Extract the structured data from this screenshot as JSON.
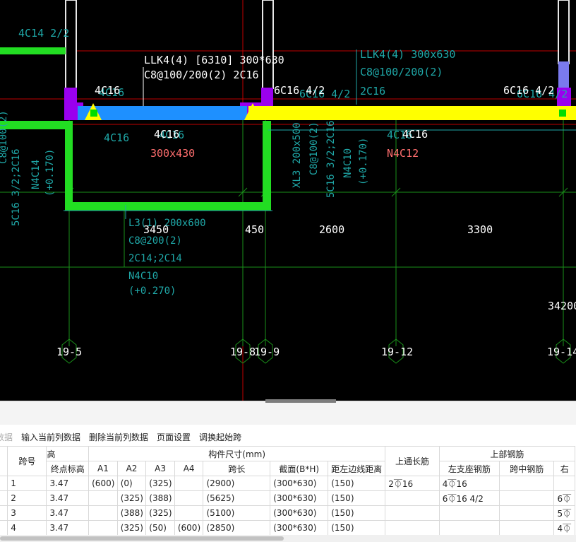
{
  "cad": {
    "beam_labels": {
      "llk4_left": "LLK4(4) [6310] 300*630",
      "llk4_left_line2": "C8@100/200(2) 2C16",
      "llk4_right": "LLK4(4) 300x630",
      "llk4_right_line2": "C8@100/200(2)",
      "llk4_right_line3": "2C16",
      "top_left_rebar": "4C14 2/2",
      "rebar_4c16_a": "4C16",
      "rebar_4c16_a_ghost": "4C16",
      "rebar_6c16_mid": "6C16 4/2",
      "rebar_6c16_mid_ghost": "6C16 4/2",
      "rebar_6c16_right": "6C16 4/2",
      "rebar_6c16_right_ghost": "6C16 4/2",
      "bottom_4c16_left": "4C16",
      "bottom_4c16_left_ghost": "4C16",
      "section_left": "300x430",
      "ghost_4c16_below": "4C16",
      "bottom_4c16_right": "4C16",
      "bottom_4c16_right_ghost": "4C16",
      "n4c12": "N4C12",
      "left_vert_1": "C8@100(2)",
      "left_vert_2": "5C16 3/2;2C16",
      "left_vert_3": "N4C14",
      "left_vert_4": "(+0.170)",
      "xl3_1": "XL3 200x500",
      "xl3_2": "C8@100(2)",
      "xl3_3": "5C16 3/2;2C16",
      "xl3_4": "N4C10",
      "xl3_5": "(+0.170)",
      "l3_1": "L3(1) 200x600",
      "l3_2": "C8@200(2)",
      "l3_3": "2C14;2C14",
      "l3_4": "N4C10",
      "l3_5": "(+0.270)"
    },
    "dimensions": [
      "3450",
      "450",
      "2600",
      "3300",
      "34200"
    ],
    "axes": [
      "19-5",
      "19-8",
      "19-9",
      "19-12",
      "19-14"
    ]
  },
  "toolbar": {
    "cut_item": "数据",
    "items": [
      "输入当前列数据",
      "删除当前列数据",
      "页面设置",
      "调换起始跨"
    ]
  },
  "table": {
    "header": {
      "span_no": "跨号",
      "elev_group": "高",
      "end_elev": "终点标高",
      "size_group": "构件尺寸(mm)",
      "a1": "A1",
      "a2": "A2",
      "a3": "A3",
      "a4": "A4",
      "span_len": "跨长",
      "section": "截面(B*H)",
      "edge_dist": "距左边线距离",
      "top_through": "上通长筋",
      "top_rebar_group": "上部钢筋",
      "left_support": "左支座钢筋",
      "mid_span": "跨中钢筋",
      "right_cut": "右"
    },
    "rows": [
      {
        "no": "1",
        "elev": "3.47",
        "a1": "(600)",
        "a2": "(0)",
        "a3": "(325)",
        "a4": "",
        "len": "(2900)",
        "sec": "(300*630)",
        "dist": "(150)",
        "through": "2⏁16",
        "left": "4⏁16",
        "mid": "",
        "right": ""
      },
      {
        "no": "2",
        "elev": "3.47",
        "a1": "",
        "a2": "(325)",
        "a3": "(388)",
        "a4": "",
        "len": "(5625)",
        "sec": "(300*630)",
        "dist": "(150)",
        "through": "",
        "left": "6⏁16 4/2",
        "mid": "",
        "right": "6⏁"
      },
      {
        "no": "3",
        "elev": "3.47",
        "a1": "",
        "a2": "(388)",
        "a3": "(325)",
        "a4": "",
        "len": "(5100)",
        "sec": "(300*630)",
        "dist": "(150)",
        "through": "",
        "left": "",
        "mid": "",
        "right": "5⏁"
      },
      {
        "no": "4",
        "elev": "3.47",
        "a1": "",
        "a2": "(325)",
        "a3": "(50)",
        "a4": "(600)",
        "len": "(2850)",
        "sec": "(300*630)",
        "dist": "(150)",
        "through": "",
        "left": "",
        "mid": "",
        "right": "4⏁"
      }
    ]
  },
  "colors": {
    "background": "#000000",
    "beam_yellow": "#ffff00",
    "beam_blue": "#1e90ff",
    "wall_green": "#22dd22",
    "support_magenta": "#9900ee",
    "annotation_cyan": "#1fa8a8",
    "section_red": "#ff6666",
    "grid_red": "#cc0000",
    "axis_green": "#1aa01a"
  }
}
